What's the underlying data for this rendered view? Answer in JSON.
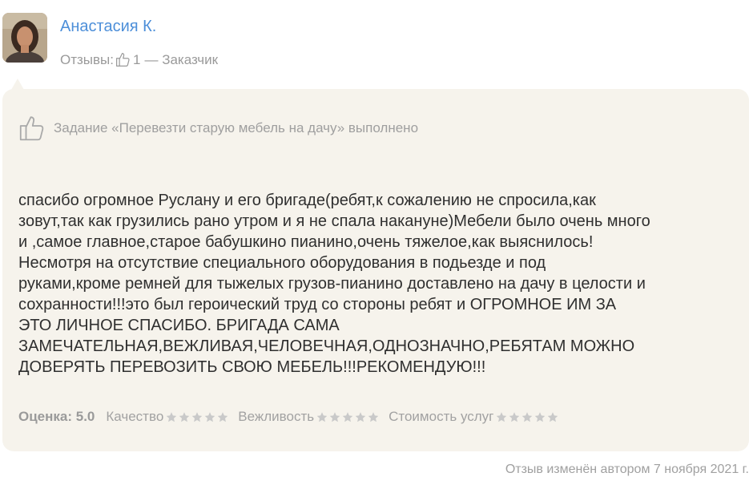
{
  "author": {
    "name": "Анастасия К.",
    "meta_label": "Отзывы:",
    "reviews_count": "1",
    "role": "— Заказчик"
  },
  "task": {
    "status_text": "Задание «Перевезти старую мебель на дачу» выполнено"
  },
  "review": {
    "text": "спасибо огромное Руслану и его бригаде(ребят,к сожалению не спросила,как\nзовут,так как грузились рано утром и я не спала накануне)Мебели было очень много\nи ,самое главное,старое бабушкино пианино,очень тяжелое,как выяснилось!\nНесмотря на отсутствие специального оборудования в подьезде и под\nруками,кроме ремней для тыжелых грузов-пианино доставлено на дачу в целости и\nсохранности!!!это был героический труд со стороны ребят и ОГРОМНОЕ ИМ ЗА\nЭТО ЛИЧНОЕ СПАСИБО.  БРИГАДА САМА\nЗАМЕЧАТЕЛЬНАЯ,ВЕЖЛИВАЯ,ЧЕЛОВЕЧНАЯ,ОДНОЗНАЧНО,РЕБЯТАМ МОЖНО\nДОВЕРЯТЬ ПЕРЕВОЗИТЬ СВОЮ МЕБЕЛЬ!!!РЕКОМЕНДУЮ!!!"
  },
  "ratings": {
    "score_text": "Оценка: 5.0",
    "quality": {
      "label": "Качество",
      "stars": 5
    },
    "politeness": {
      "label": "Вежливость",
      "stars": 5
    },
    "cost": {
      "label": "Стоимость услуг",
      "stars": 5
    }
  },
  "footer": {
    "edited_note": "Отзыв изменён автором 7 ноября 2021 г."
  },
  "colors": {
    "link": "#4d8fd9",
    "card_bg": "#f6f3ec",
    "star": "#c9c9c9"
  },
  "icons": [
    "avatar-photo",
    "thumbs-up-icon",
    "star-icon"
  ]
}
